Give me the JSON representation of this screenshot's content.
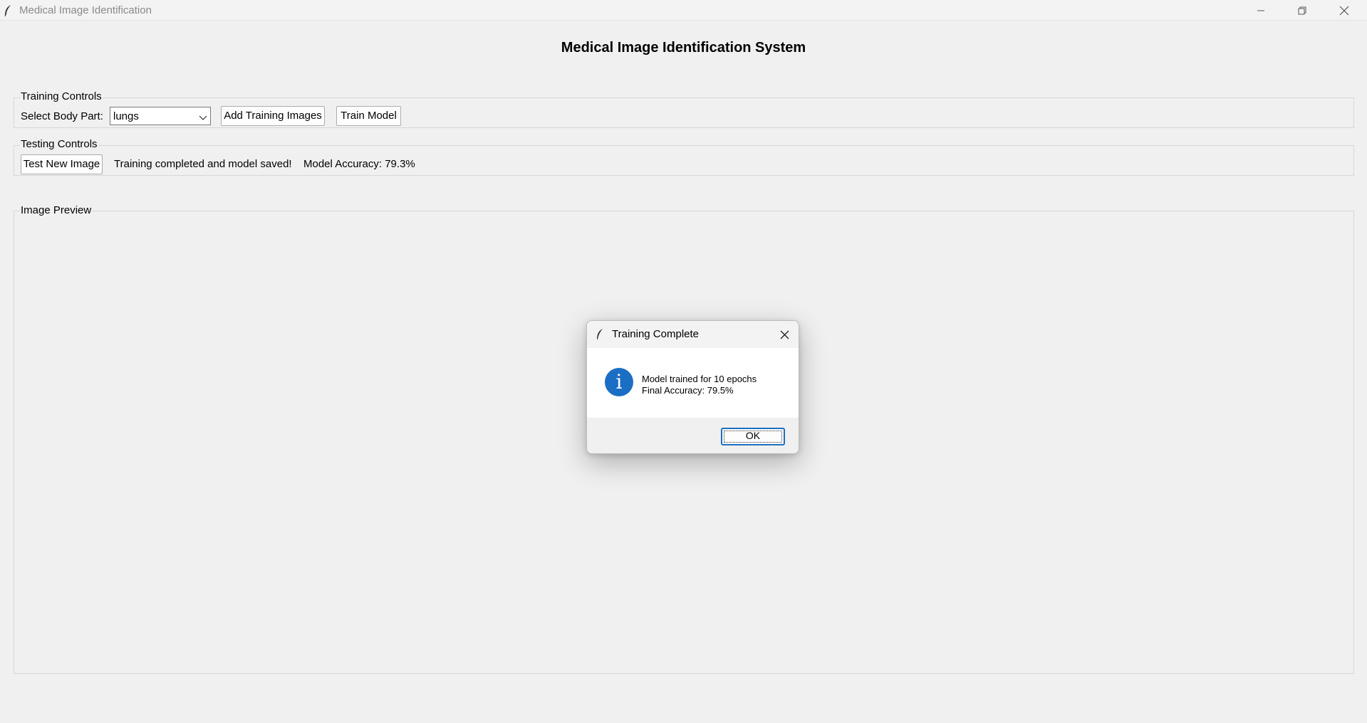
{
  "window": {
    "title": "Medical Image Identification"
  },
  "app": {
    "heading": "Medical Image Identification System"
  },
  "training_controls": {
    "group_label": "Training Controls",
    "body_part_label": "Select Body Part:",
    "body_part_value": "lungs",
    "add_images_label": "Add Training Images",
    "train_label": "Train Model"
  },
  "testing_controls": {
    "group_label": "Testing Controls",
    "test_label": "Test New Image",
    "status_text": "Training completed and model saved!",
    "accuracy_text": "Model Accuracy: 79.3%"
  },
  "preview": {
    "group_label": "Image Preview"
  },
  "dialog": {
    "title": "Training Complete",
    "message_line1": "Model trained for 10 epochs",
    "message_line2": "Final Accuracy: 79.5%",
    "ok_label": "OK",
    "icon": "info-icon",
    "icon_color": "#1a6fc4"
  }
}
